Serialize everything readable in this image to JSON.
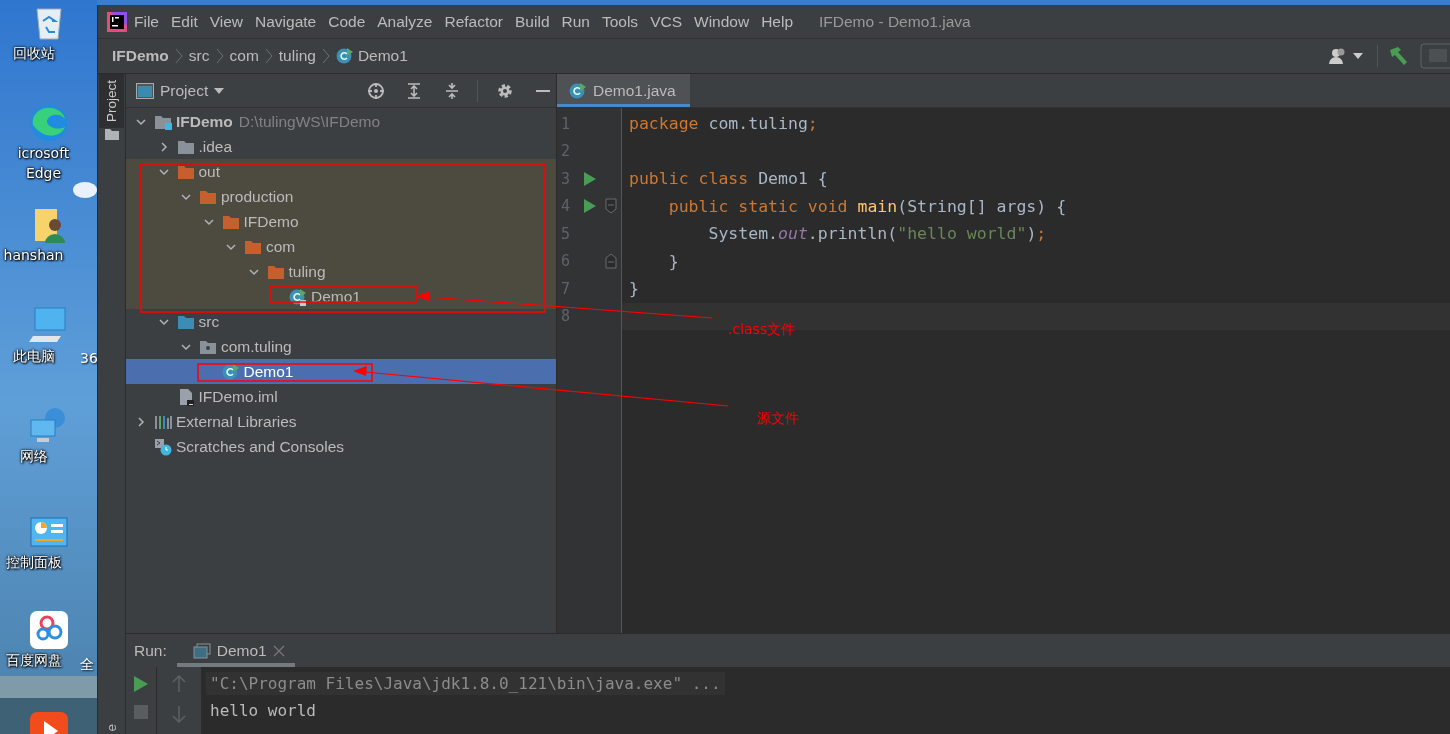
{
  "desktop": {
    "icons": [
      {
        "kind": "recycle-bin",
        "label": "回收站"
      },
      {
        "kind": "browser",
        "label": "icrosoft Edge"
      },
      {
        "kind": "user-folder",
        "label": "hanshan"
      },
      {
        "kind": "computer",
        "label": "此电脑"
      },
      {
        "kind": "network",
        "label": "网络"
      },
      {
        "kind": "control-panel",
        "label": "控制面板"
      },
      {
        "kind": "cloud-drive",
        "label": "百度网盘"
      },
      {
        "kind": "video-app"
      }
    ],
    "partial_labels": [
      "36",
      "全"
    ]
  },
  "window": {
    "title": "IFDemo - Demo1.java",
    "menu": [
      {
        "label": "File"
      },
      {
        "label": "Edit"
      },
      {
        "label": "View"
      },
      {
        "label": "Navigate"
      },
      {
        "label": "Code"
      },
      {
        "label": "Analyze"
      },
      {
        "label": "Refactor"
      },
      {
        "label": "Build"
      },
      {
        "label": "Run"
      },
      {
        "label": "Tools"
      },
      {
        "label": "VCS"
      },
      {
        "label": "Window"
      },
      {
        "label": "Help"
      }
    ]
  },
  "breadcrumb": [
    {
      "label": "IFDemo",
      "kind": "project"
    },
    {
      "label": "src",
      "kind": "folder"
    },
    {
      "label": "com",
      "kind": "folder"
    },
    {
      "label": "tuling",
      "kind": "folder"
    },
    {
      "label": "Demo1",
      "kind": "class"
    }
  ],
  "tool_strip": {
    "tabs": [
      {
        "label": "Project",
        "selected": true
      },
      {
        "label": "e",
        "selected": false
      }
    ]
  },
  "project_panel": {
    "title": "Project",
    "tree": [
      {
        "label": "IFDemo",
        "path": "D:\\tulingWS\\IFDemo",
        "kind": "module",
        "expanded": true,
        "selected": false,
        "excluded": false,
        "children": [
          {
            "label": ".idea",
            "kind": "folder",
            "expanded": false,
            "selected": false,
            "excluded": false
          },
          {
            "label": "out",
            "kind": "excluded-folder",
            "expanded": true,
            "selected": false,
            "excluded": true,
            "children": [
              {
                "label": "production",
                "kind": "excluded-folder",
                "expanded": true,
                "selected": false,
                "excluded": true,
                "children": [
                  {
                    "label": "IFDemo",
                    "kind": "excluded-folder",
                    "expanded": true,
                    "selected": false,
                    "excluded": true,
                    "children": [
                      {
                        "label": "com",
                        "kind": "excluded-folder",
                        "expanded": true,
                        "selected": false,
                        "excluded": true,
                        "children": [
                          {
                            "label": "tuling",
                            "kind": "excluded-folder",
                            "expanded": true,
                            "selected": false,
                            "excluded": true,
                            "children": [
                              {
                                "label": "Demo1",
                                "kind": "compiled-class",
                                "selected": false,
                                "excluded": true
                              }
                            ]
                          }
                        ]
                      }
                    ]
                  }
                ]
              }
            ]
          },
          {
            "label": "src",
            "kind": "source-folder",
            "expanded": true,
            "selected": false,
            "excluded": false,
            "children": [
              {
                "label": "com.tuling",
                "kind": "package",
                "expanded": true,
                "selected": false,
                "excluded": false,
                "children": [
                  {
                    "label": "Demo1",
                    "kind": "class",
                    "selected": true
                  }
                ]
              }
            ]
          },
          {
            "label": "IFDemo.iml",
            "kind": "module-file",
            "selected": false,
            "excluded": false
          }
        ]
      },
      {
        "label": "External Libraries",
        "kind": "libraries",
        "expanded": false,
        "selected": false,
        "excluded": false
      },
      {
        "label": "Scratches and Consoles",
        "kind": "scratches",
        "selected": false,
        "excluded": false
      }
    ]
  },
  "editor": {
    "tabs": [
      {
        "label": "Demo1.java",
        "selected": true
      }
    ],
    "lines": [
      {
        "number": "1",
        "kind": "plain",
        "run": false,
        "current": false,
        "tokens": [
          {
            "text": "package",
            "kind": "keyword"
          },
          {
            "text": " com.tuling",
            "kind": "plain"
          },
          {
            "text": ";",
            "kind": "keyword"
          }
        ]
      },
      {
        "number": "2",
        "kind": "plain",
        "run": false,
        "current": false
      },
      {
        "number": "3",
        "kind": "plain",
        "run": true,
        "current": false,
        "tokens": [
          {
            "text": "public class",
            "kind": "keyword"
          },
          {
            "text": " Demo1 {",
            "kind": "plain"
          }
        ]
      },
      {
        "number": "4",
        "kind": "fold-start",
        "run": true,
        "current": false,
        "tokens": [
          {
            "text": "    public static void ",
            "kind": "keyword"
          },
          {
            "text": "main",
            "kind": "method"
          },
          {
            "text": "(String[] args) {",
            "kind": "plain"
          }
        ]
      },
      {
        "number": "5",
        "kind": "plain",
        "run": false,
        "current": false,
        "tokens": [
          {
            "text": "        System.",
            "kind": "plain"
          },
          {
            "text": "out",
            "kind": "static-field"
          },
          {
            "text": ".println(",
            "kind": "plain"
          },
          {
            "text": "\"hello world\"",
            "kind": "string"
          },
          {
            "text": ")",
            "kind": "plain"
          },
          {
            "text": ";",
            "kind": "keyword"
          }
        ]
      },
      {
        "number": "6",
        "kind": "fold-end",
        "run": false,
        "current": false,
        "tokens": [
          {
            "text": "    }",
            "kind": "plain"
          }
        ]
      },
      {
        "number": "7",
        "kind": "plain",
        "run": false,
        "current": false,
        "tokens": [
          {
            "text": "}",
            "kind": "plain"
          }
        ]
      },
      {
        "number": "8",
        "kind": "plain",
        "run": false,
        "current": true
      }
    ]
  },
  "run_panel": {
    "label": "Run:",
    "tabs": [
      {
        "label": "Demo1",
        "selected": true
      }
    ],
    "console": [
      {
        "text": "\"C:\\Program Files\\Java\\jdk1.8.0_121\\bin\\java.exe\" ...",
        "kind": "command"
      },
      {
        "text": "hello world",
        "kind": "output"
      }
    ]
  },
  "annotations": [
    {
      "text": ".class文件"
    },
    {
      "text": "源文件"
    }
  ]
}
